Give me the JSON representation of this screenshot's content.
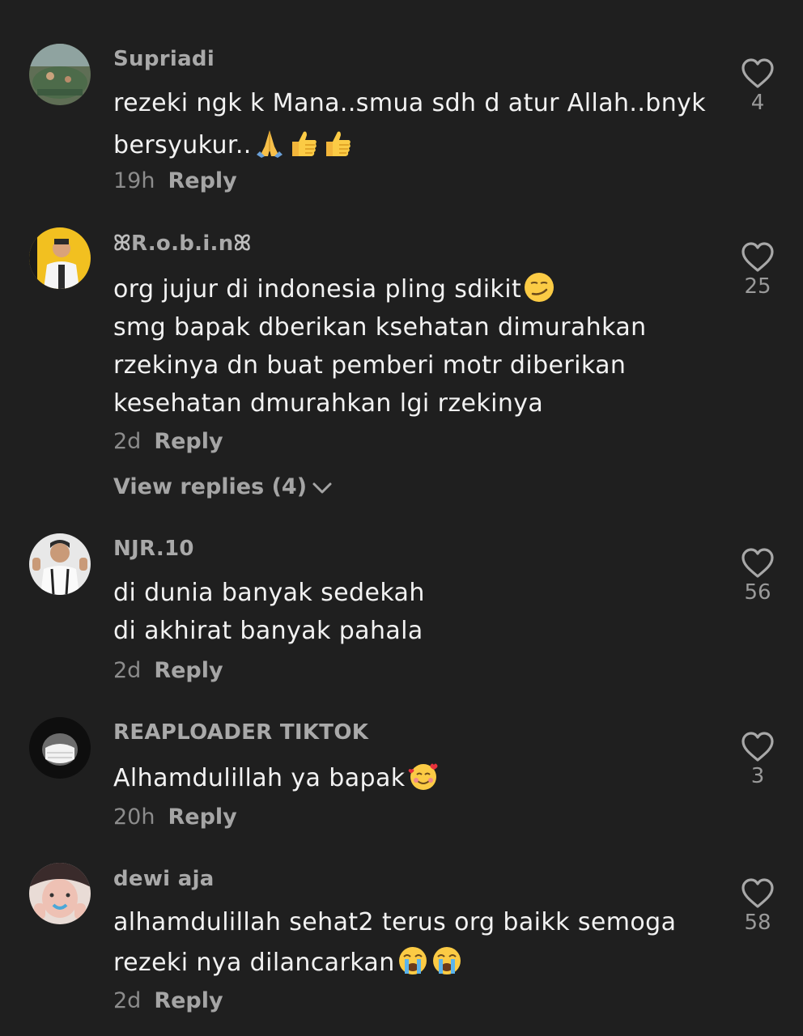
{
  "comments": [
    {
      "username": "Supriadi",
      "lines": [
        "rezeki ngk k Mana..smua sdh d atur Allah..bnyk",
        "bersyukur.."
      ],
      "time": "19h",
      "reply_label": "Reply",
      "likes": "4",
      "emojis": [
        "folded-hands-emoji",
        "thumbs-up-emoji",
        "thumbs-up-emoji"
      ]
    },
    {
      "username": "R.o.b.i.n",
      "lines": [
        "org jujur di indonesia pling sdikit",
        "smg bapak dberikan ksehatan dimurahkan",
        "rzekinya dn buat pemberi motr diberikan",
        "kesehatan dmurahkan lgi rzekinya"
      ],
      "time": "2d",
      "reply_label": "Reply",
      "likes": "25",
      "view_replies": "View replies (4)",
      "emojis": [
        "smirk-emoji"
      ]
    },
    {
      "username": "NJR.10",
      "lines": [
        "di dunia banyak sedekah",
        "di akhirat banyak pahala"
      ],
      "time": "2d",
      "reply_label": "Reply",
      "likes": "56"
    },
    {
      "username": "REAPLOADER TIKTOK",
      "lines": [
        "Alhamdulillah ya bapak"
      ],
      "time": "20h",
      "reply_label": "Reply",
      "likes": "3",
      "emojis": [
        "smiling-hearts-emoji"
      ]
    },
    {
      "username": "dewi aja",
      "lines": [
        "alhamdulillah sehat2 terus org baikk semoga",
        "rezeki nya dilancarkan"
      ],
      "time": "2d",
      "reply_label": "Reply",
      "likes": "58",
      "emojis": [
        "crying-emoji",
        "crying-emoji"
      ]
    }
  ],
  "colors": {
    "background": "#1f1f1f",
    "text": "#f2f2f2",
    "muted": "#a9a9a9"
  }
}
